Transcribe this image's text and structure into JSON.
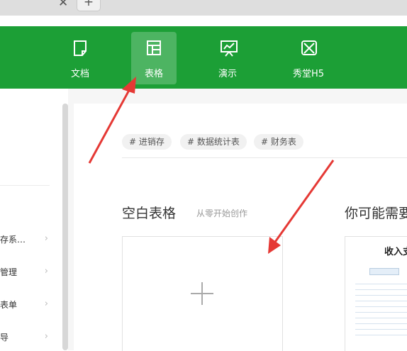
{
  "browser": {
    "close_glyph": "✕",
    "new_tab_glyph": "+"
  },
  "toolbar": {
    "bg_color": "#1c9f36",
    "items": [
      {
        "label": "文档",
        "icon": "document-icon",
        "active": false
      },
      {
        "label": "表格",
        "icon": "spreadsheet-icon",
        "active": true
      },
      {
        "label": "演示",
        "icon": "presentation-icon",
        "active": false
      },
      {
        "label": "秀堂H5",
        "icon": "h5-icon",
        "active": false
      }
    ]
  },
  "sidebar": {
    "items": [
      {
        "label": "存系…"
      },
      {
        "label": "管理"
      },
      {
        "label": "表单"
      },
      {
        "label": "导"
      }
    ],
    "chevron": "›"
  },
  "tags": [
    "# 进销存",
    "# 数据统计表",
    "# 财务表"
  ],
  "blank_section": {
    "title": "空白表格",
    "subtitle": "从零开始创作"
  },
  "suggest_section": {
    "title": "你可能需要",
    "template_title": "收入支"
  },
  "annotation_color": "#e53935"
}
